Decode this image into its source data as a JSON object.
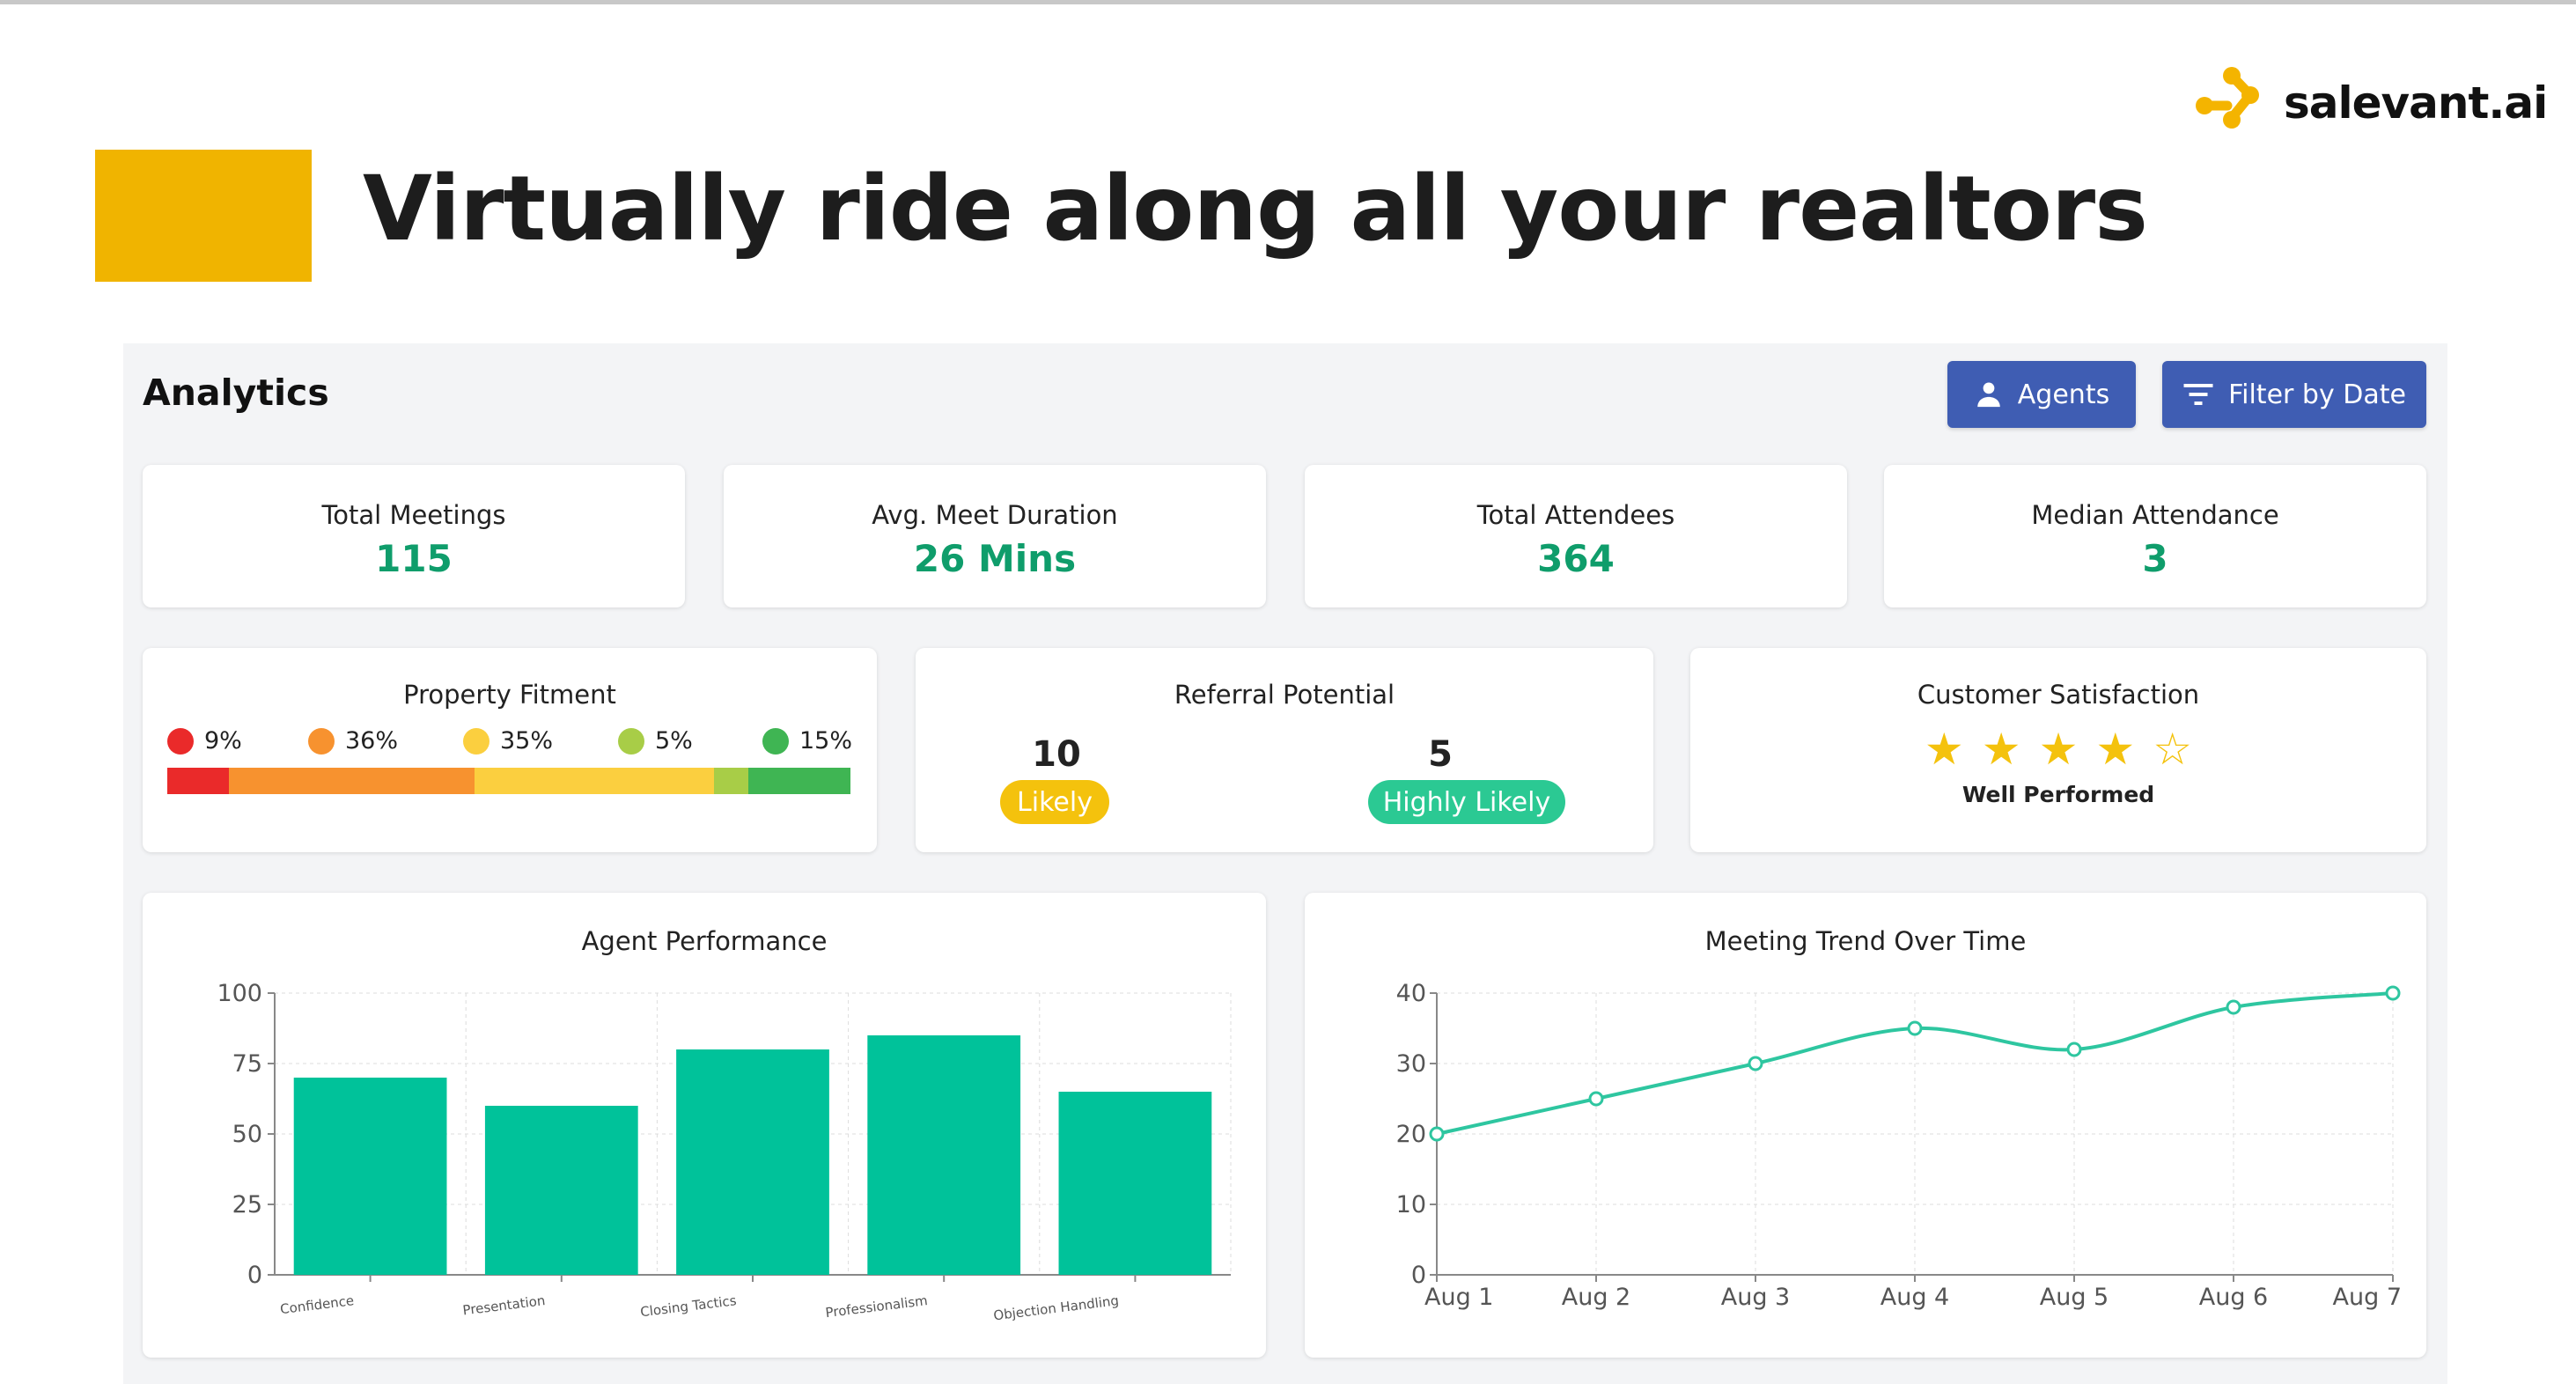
{
  "slide": {
    "title": "Virtually ride along all your realtors",
    "accent_color": "#f0b400"
  },
  "logo": {
    "text": "salevant.ai",
    "icon": "connected-nodes-logo-icon",
    "color": "#f4b400"
  },
  "analytics": {
    "title": "Analytics",
    "buttons": {
      "agents": {
        "label": "Agents",
        "icon": "user-icon"
      },
      "filter": {
        "label": "Filter by Date",
        "icon": "filter-icon"
      },
      "color": "#3f5db3"
    },
    "kpis": [
      {
        "label": "Total Meetings",
        "value": "115"
      },
      {
        "label": "Avg. Meet Duration",
        "value": "26 Mins"
      },
      {
        "label": "Total Attendees",
        "value": "364"
      },
      {
        "label": "Median Attendance",
        "value": "3"
      }
    ],
    "kpi_value_color": "#0f9d6b",
    "property_fitment": {
      "label": "Property Fitment",
      "segments": [
        {
          "label": "9%",
          "percent": 9,
          "color": "#ea2a2a"
        },
        {
          "label": "36%",
          "percent": 36,
          "color": "#f7922f"
        },
        {
          "label": "35%",
          "percent": 35,
          "color": "#fbcf3f"
        },
        {
          "label": "5%",
          "percent": 5,
          "color": "#a8cd47"
        },
        {
          "label": "15%",
          "percent": 15,
          "color": "#3fb553"
        }
      ]
    },
    "referral_potential": {
      "label": "Referral Potential",
      "likely": {
        "count": "10",
        "label": "Likely",
        "color": "#f4c20d"
      },
      "highly_likely": {
        "count": "5",
        "label": "Highly Likely",
        "color": "#2bc993"
      }
    },
    "customer_satisfaction": {
      "label": "Customer Satisfaction",
      "rating": 4,
      "max_rating": 5,
      "text": "Well Performed",
      "star_color": "#f4c20d"
    }
  },
  "chart_data": [
    {
      "type": "bar",
      "title": "Agent Performance",
      "categories": [
        "Confidence",
        "Presentation",
        "Closing Tactics",
        "Professionalism",
        "Objection Handling"
      ],
      "values": [
        70,
        60,
        80,
        85,
        65
      ],
      "ylim": [
        0,
        100
      ],
      "yticks": [
        0,
        25,
        50,
        75,
        100
      ],
      "grid": true,
      "color": "#00c29a"
    },
    {
      "type": "line",
      "title": "Meeting Trend Over Time",
      "categories": [
        "Aug 1",
        "Aug 2",
        "Aug 3",
        "Aug 4",
        "Aug 5",
        "Aug 6",
        "Aug 7"
      ],
      "values": [
        20,
        25,
        30,
        35,
        32,
        38,
        40
      ],
      "ylim": [
        0,
        40
      ],
      "yticks": [
        0,
        10,
        20,
        30,
        40
      ],
      "grid": true,
      "color": "#2ec6a0"
    }
  ]
}
